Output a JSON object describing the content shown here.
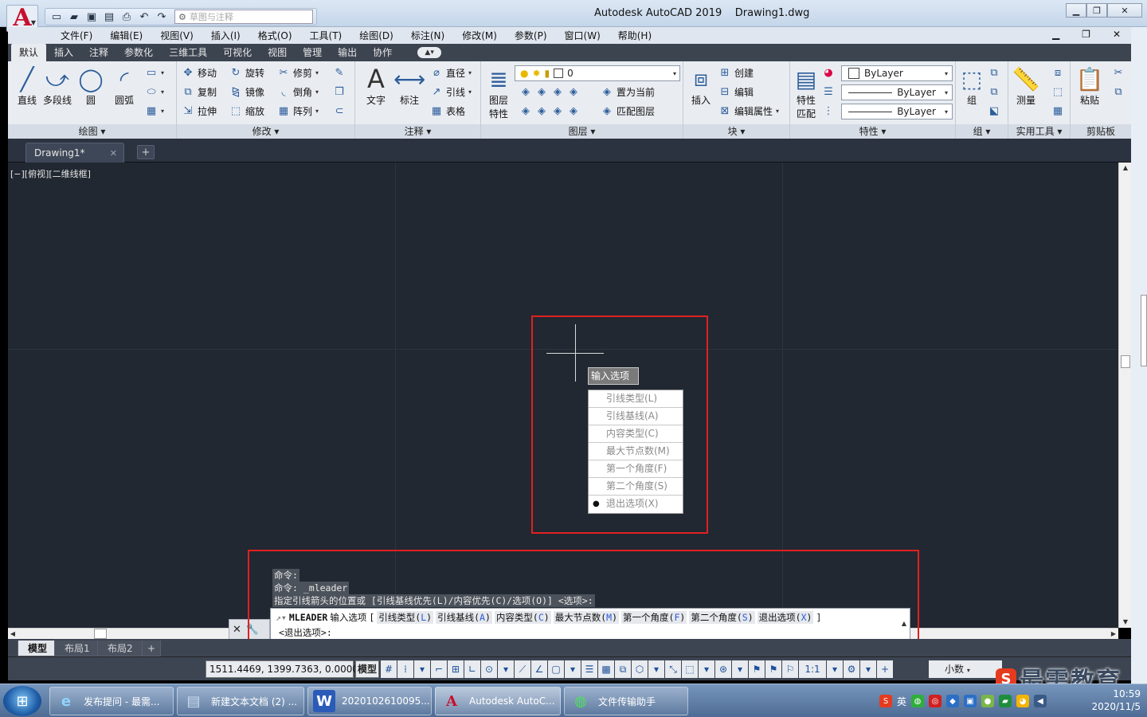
{
  "window": {
    "title": "Autodesk AutoCAD 2019",
    "document": "Drawing1.dwg",
    "workspace_placeholder": "草图与注释"
  },
  "menu": [
    "文件(F)",
    "编辑(E)",
    "视图(V)",
    "插入(I)",
    "格式(O)",
    "工具(T)",
    "绘图(D)",
    "标注(N)",
    "修改(M)",
    "参数(P)",
    "窗口(W)",
    "帮助(H)"
  ],
  "ribbon_tabs": [
    "默认",
    "插入",
    "注释",
    "参数化",
    "三维工具",
    "可视化",
    "视图",
    "管理",
    "输出",
    "协作"
  ],
  "ribbon": {
    "draw": {
      "title": "绘图",
      "line": "直线",
      "polyline": "多段线",
      "circle": "圆",
      "arc": "圆弧"
    },
    "modify": {
      "title": "修改",
      "move": "移动",
      "rotate": "旋转",
      "trim": "修剪",
      "copy": "复制",
      "mirror": "镜像",
      "fillet": "倒角",
      "stretch": "拉伸",
      "scale": "缩放",
      "array": "阵列"
    },
    "annotation": {
      "title": "注释",
      "text": "文字",
      "dimension": "标注",
      "diameter": "直径",
      "leader": "引线",
      "table": "表格"
    },
    "layers": {
      "title": "图层",
      "layer_props_1": "图层",
      "layer_props_2": "特性",
      "current_layer": "0",
      "set_current": "置为当前",
      "match_layer": "匹配图层"
    },
    "block": {
      "title": "块",
      "insert": "插入",
      "create": "创建",
      "edit": "编辑",
      "edit_attr": "编辑属性"
    },
    "properties": {
      "title": "特性",
      "match_1": "特性",
      "match_2": "匹配",
      "color": "ByLayer",
      "linetype": "ByLayer",
      "lineweight": "ByLayer"
    },
    "group": {
      "title": "组",
      "group": "组"
    },
    "utilities": {
      "title": "实用工具",
      "measure": "测量"
    },
    "clipboard": {
      "title": "剪贴板",
      "paste": "粘贴"
    }
  },
  "file_tab": {
    "name": "Drawing1*"
  },
  "viewport_label": "[−][俯视][二维线框]",
  "dynamic_input": {
    "tooltip": "输入选项",
    "options": [
      {
        "label": "引线类型(L)",
        "selected": false
      },
      {
        "label": "引线基线(A)",
        "selected": false
      },
      {
        "label": "内容类型(C)",
        "selected": false
      },
      {
        "label": "最大节点数(M)",
        "selected": false
      },
      {
        "label": "第一个角度(F)",
        "selected": false
      },
      {
        "label": "第二个角度(S)",
        "selected": false
      },
      {
        "label": "退出选项(X)",
        "selected": true
      }
    ]
  },
  "command_history": [
    "命令:",
    "命令: _mleader",
    "指定引线箭头的位置或 [引线基线优先(L)/内容优先(C)/选项(O)] <选项>:"
  ],
  "command_line": {
    "command": "MLEADER",
    "prompt": "输入选项",
    "open_bracket": "[",
    "close_bracket": "]",
    "options": [
      {
        "text": "引线类型(",
        "key": "L",
        "end": ")"
      },
      {
        "text": "引线基线(",
        "key": "A",
        "end": ")"
      },
      {
        "text": "内容类型(",
        "key": "C",
        "end": ")"
      },
      {
        "text": "最大节点数(",
        "key": "M",
        "end": ")"
      },
      {
        "text": "第一个角度(",
        "key": "F",
        "end": ")"
      },
      {
        "text": "第二个角度(",
        "key": "S",
        "end": ")"
      },
      {
        "text": "退出选项(",
        "key": "X",
        "end": ")"
      }
    ],
    "second_line": "<退出选项>:"
  },
  "layout_tabs": [
    "模型",
    "布局1",
    "布局2"
  ],
  "status": {
    "coordinates": "1511.4469, 1399.7363, 0.0000",
    "model": "模型",
    "scale": "1:1",
    "units": "小数"
  },
  "taskbar": {
    "items": [
      "发布提问 - 最需...",
      "新建文本文档 (2) ...",
      "2020102610095...",
      "Autodesk AutoC...",
      "文件传输助手"
    ],
    "tray_lang": "英",
    "time": "10:59",
    "date": "2020/11/5"
  },
  "watermark": "最需教育",
  "colors": {
    "highlight_box": "#e02020",
    "canvas": "#212832",
    "accent_blue": "#2a5bd7",
    "brand_red": "#c8102e"
  }
}
